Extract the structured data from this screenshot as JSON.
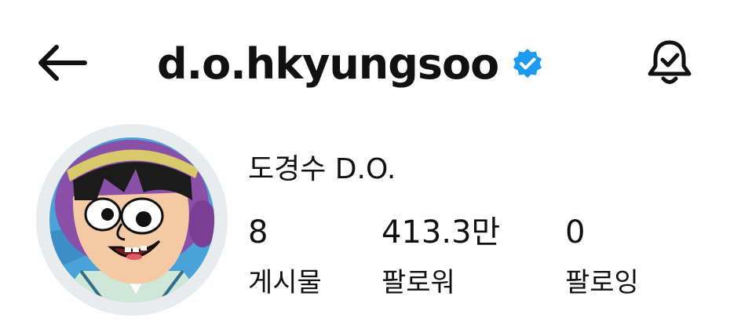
{
  "header": {
    "username": "d.o.hkyungsoo",
    "verified_color": "#1d9bf0",
    "back_icon": "back-arrow-icon",
    "notification_icon": "bell-check-icon"
  },
  "profile": {
    "display_name": "도경수 D.O.",
    "avatar": "cartoon-character-avatar"
  },
  "stats": {
    "posts": {
      "value": "8",
      "label": "게시물"
    },
    "followers": {
      "value": "413.3만",
      "label": "팔로워"
    },
    "following": {
      "value": "0",
      "label": "팔로잉"
    }
  }
}
